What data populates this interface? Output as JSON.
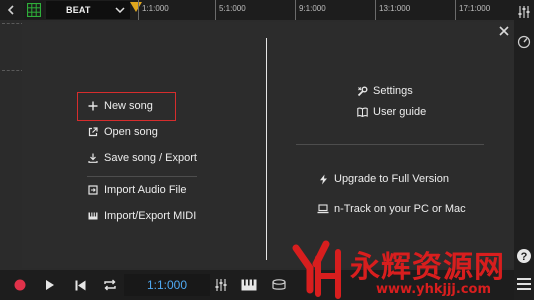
{
  "topbar": {
    "beat_label": "BEAT",
    "ruler_marks": [
      "1:1:000",
      "5:1:000",
      "9:1:000",
      "13:1:000",
      "17:1:000"
    ]
  },
  "dialog": {
    "left_menu": [
      {
        "label": "New song",
        "icon": "plus-icon"
      },
      {
        "label": "Open song",
        "icon": "open-external-icon"
      },
      {
        "label": "Save song / Export",
        "icon": "download-icon"
      },
      {
        "label": "Import Audio File",
        "icon": "import-icon"
      },
      {
        "label": "Import/Export MIDI",
        "icon": "piano-keys-icon"
      }
    ],
    "right_menu": [
      {
        "label": "Settings",
        "icon": "wrench-icon"
      },
      {
        "label": "User guide",
        "icon": "book-icon"
      },
      {
        "label": "Upgrade to Full Version",
        "icon": "bolt-icon"
      },
      {
        "label": "n-Track on your PC or Mac",
        "icon": "laptop-icon"
      }
    ]
  },
  "bottombar": {
    "time": "1:1:000"
  },
  "watermark": {
    "brand": "永辉资源网",
    "url": "www.yhkjjj.com"
  },
  "colors": {
    "accent_blue": "#4fa9f2",
    "record_red": "#e0324a",
    "highlight_red": "#d62d2d",
    "marker_yellow": "#e0a71e",
    "grid_green": "#2fae3a"
  }
}
